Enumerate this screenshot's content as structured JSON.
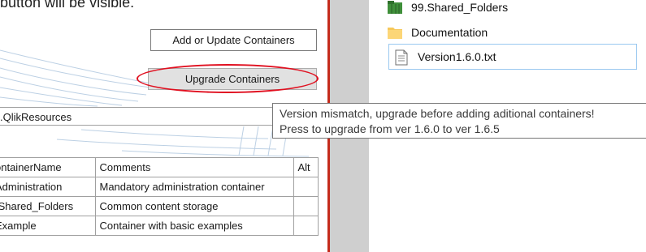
{
  "instructions": {
    "visible_fragment": "button will be visible."
  },
  "toolbar": {
    "add_update_label": "Add or Update Containers",
    "upgrade_label": "Upgrade Containers"
  },
  "path_field": {
    "value": ".QlikResources"
  },
  "containers_table": {
    "columns": [
      "ontainerName",
      "Comments",
      "Alt"
    ],
    "rows": [
      {
        "name": "Administration",
        "comment": "Mandatory administration container"
      },
      {
        "name": ".Shared_Folders",
        "comment": "Common content storage"
      },
      {
        "name": "Example",
        "comment": "Container with basic examples"
      }
    ]
  },
  "explorer": {
    "items": [
      {
        "name": "99.Shared_Folders",
        "icon": "folder-green-icon"
      },
      {
        "name": "Documentation",
        "icon": "folder-icon"
      },
      {
        "name": "Version1.6.0.txt",
        "icon": "text-file-icon"
      }
    ]
  },
  "tooltip": {
    "line1": "Version mismatch, upgrade before adding aditional containers!",
    "line2": "Press to upgrade from ver 1.6.0 to ver 1.6.5"
  },
  "colors": {
    "highlight": "#e01020",
    "divider": "#c42b1c",
    "folder": "#f6c85a",
    "selection_border": "#99c8f0"
  }
}
